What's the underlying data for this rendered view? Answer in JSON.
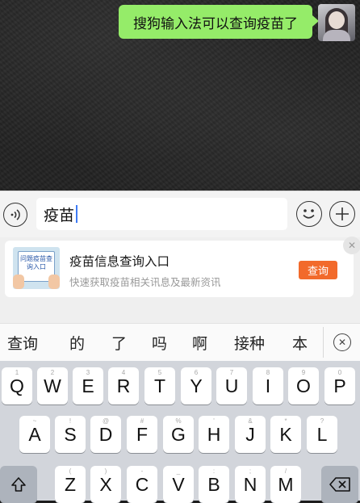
{
  "chat": {
    "message": "搜狗输入法可以查询疫苗了"
  },
  "input": {
    "value": "疫苗"
  },
  "suggestion": {
    "thumb_text": "问题疫苗查询入口",
    "title": "疫苗信息查询入口",
    "subtitle": "快速获取疫苗相关讯息及最新资讯",
    "button": "查询"
  },
  "candidates": [
    "查询",
    "的",
    "了",
    "吗",
    "啊",
    "接种",
    "本"
  ],
  "keyboard": {
    "row1": [
      {
        "key": "Q",
        "hint": "1"
      },
      {
        "key": "W",
        "hint": "2"
      },
      {
        "key": "E",
        "hint": "3"
      },
      {
        "key": "R",
        "hint": "4"
      },
      {
        "key": "T",
        "hint": "5"
      },
      {
        "key": "Y",
        "hint": "6"
      },
      {
        "key": "U",
        "hint": "7"
      },
      {
        "key": "I",
        "hint": "8"
      },
      {
        "key": "O",
        "hint": "9"
      },
      {
        "key": "P",
        "hint": "0"
      }
    ],
    "row2": [
      {
        "key": "A",
        "hint": "~"
      },
      {
        "key": "S",
        "hint": "!"
      },
      {
        "key": "D",
        "hint": "@"
      },
      {
        "key": "F",
        "hint": "#"
      },
      {
        "key": "G",
        "hint": "%"
      },
      {
        "key": "H",
        "hint": "'"
      },
      {
        "key": "J",
        "hint": "&"
      },
      {
        "key": "K",
        "hint": "*"
      },
      {
        "key": "L",
        "hint": "?"
      }
    ],
    "row3": [
      {
        "key": "Z",
        "hint": "("
      },
      {
        "key": "X",
        "hint": ")"
      },
      {
        "key": "C",
        "hint": "-"
      },
      {
        "key": "V",
        "hint": "_"
      },
      {
        "key": "B",
        "hint": ":"
      },
      {
        "key": "N",
        "hint": ";"
      },
      {
        "key": "M",
        "hint": "/"
      }
    ]
  }
}
